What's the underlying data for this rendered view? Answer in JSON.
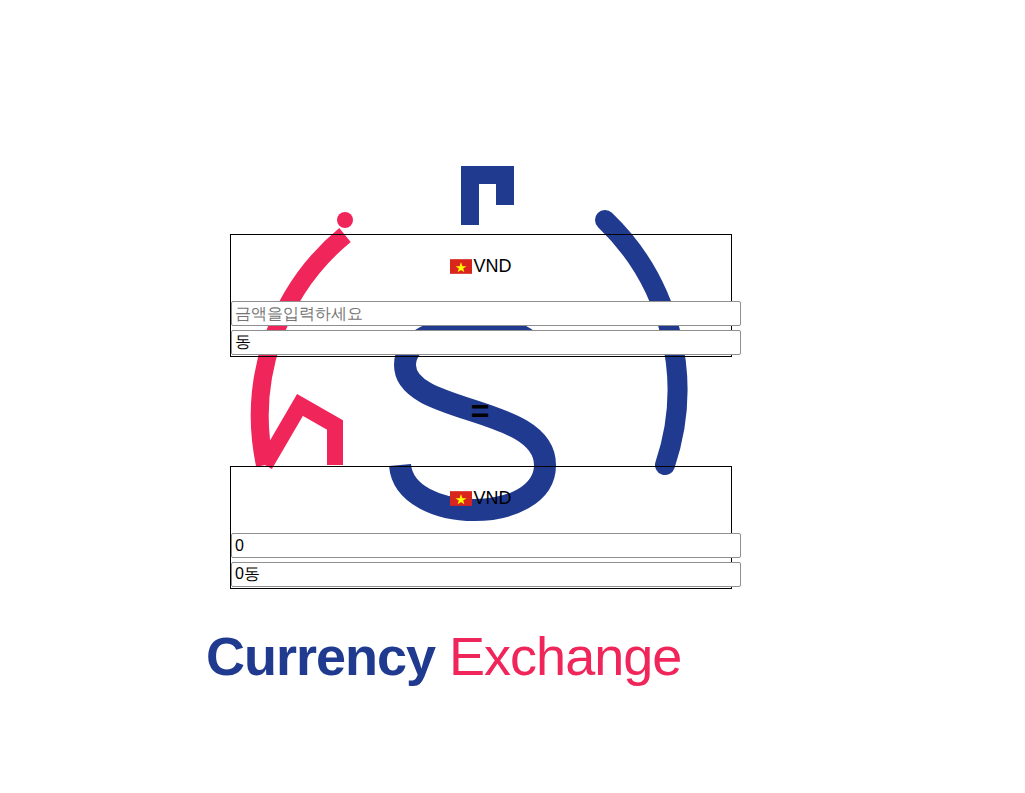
{
  "converter": [
    {
      "currency": "VND",
      "amount": "",
      "placeholder": "금액을입력하세요",
      "formatted": "동"
    },
    {
      "currency": "VND",
      "amount": "0",
      "placeholder": "",
      "formatted": "0동"
    }
  ],
  "equals": "=",
  "logo": {
    "primary": "Currency",
    "secondary": "Exchange"
  }
}
